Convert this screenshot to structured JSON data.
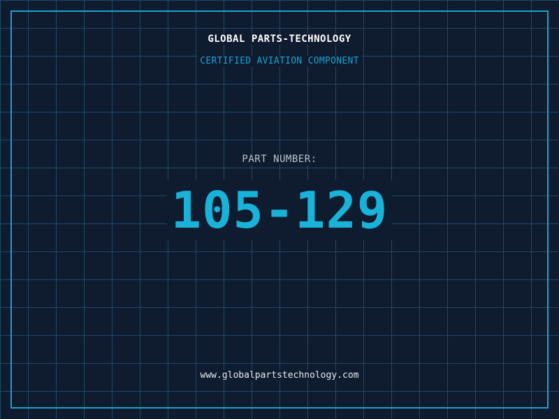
{
  "header": {
    "company_name": "GLOBAL PARTS-TECHNOLOGY",
    "subtitle": "CERTIFIED AVIATION COMPONENT"
  },
  "part": {
    "label": "PART NUMBER:",
    "number": "105-129"
  },
  "footer": {
    "url": "www.globalpartstechnology.com"
  },
  "colors": {
    "background": "#0f1b2e",
    "grid": "#1d4b66",
    "accent": "#1aa3cf",
    "part_number": "#19b2d9",
    "label": "#b6c6d6",
    "title": "#ffffff"
  }
}
